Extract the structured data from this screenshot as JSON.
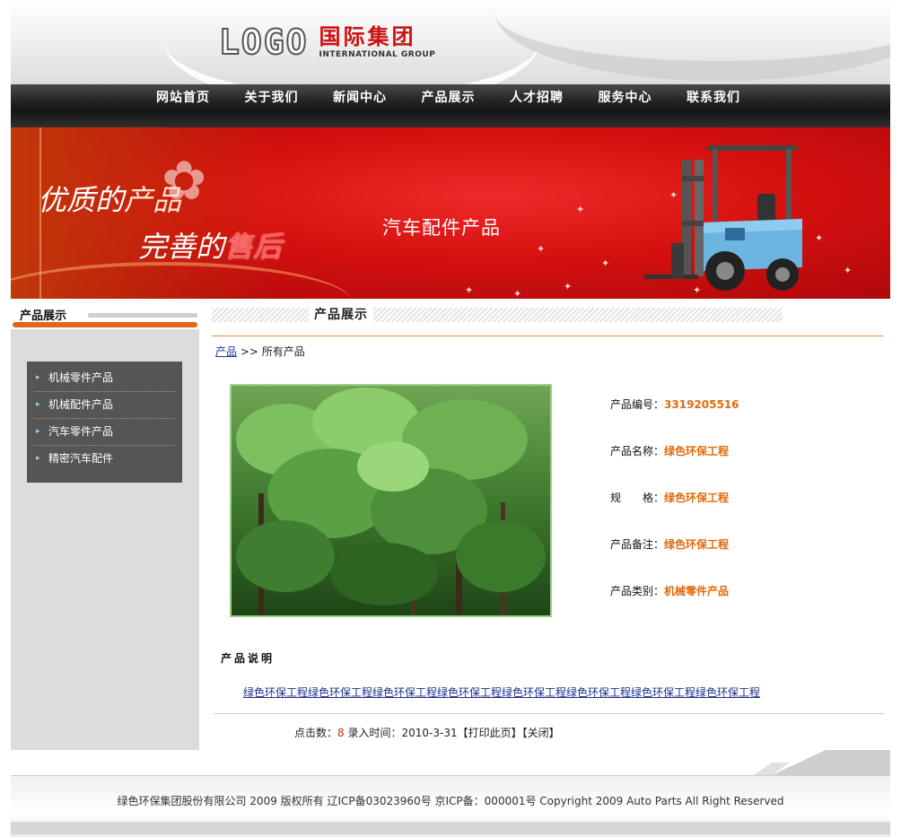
{
  "header": {
    "logo_word": "LOGO",
    "logo_cn": "国际集团",
    "logo_en": "INTERNATIONAL GROUP"
  },
  "nav": {
    "items": [
      "网站首页",
      "关于我们",
      "新闻中心",
      "产品展示",
      "人才招聘",
      "服务中心",
      "联系我们"
    ]
  },
  "banner": {
    "slogan1_a": "优质的",
    "slogan1_b": "产品",
    "slogan2_a": "完善的",
    "slogan2_b": "售后",
    "title": "汽车配件产品"
  },
  "sidebar": {
    "title": "产品展示",
    "items": [
      "机械零件产品",
      "机械配件产品",
      "汽车零件产品",
      "精密汽车配件"
    ]
  },
  "main": {
    "title": "产品展示",
    "breadcrumb_link": "产品",
    "breadcrumb_rest": " >> 所有产品",
    "attributes": [
      {
        "label": "产品编号：",
        "value": "3319205516"
      },
      {
        "label": "产品名称：",
        "value": "绿色环保工程"
      },
      {
        "label": "规　　格：",
        "value": "绿色环保工程"
      },
      {
        "label": "产品备注：",
        "value": "绿色环保工程"
      },
      {
        "label": "产品类别：",
        "value": "机械零件产品"
      }
    ],
    "desc_title": "产品说明",
    "desc_text": "绿色环保工程绿色环保工程绿色环保工程绿色环保工程绿色环保工程绿色环保工程绿色环保工程绿色环保工程",
    "clicks_label": "点击数：",
    "clicks": "8",
    "time_label": " 录入时间：",
    "time": "2010-3-31",
    "print_label": "【打印此页】",
    "close_label": "【关闭】"
  },
  "footer": {
    "text": "绿色环保集团股份有限公司 2009 版权所有 辽ICP备03023960号 京ICP备：000001号 Copyright 2009 Auto Parts All Right Reserved"
  },
  "colors": {
    "accent_orange": "#e26712",
    "nav_bg": "#1e1e1e",
    "banner_red": "#d4100f",
    "link_blue": "#1a2f8a"
  }
}
